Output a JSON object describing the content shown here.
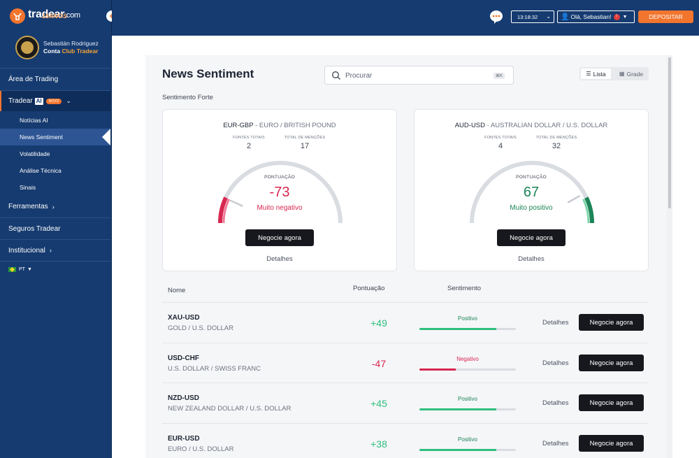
{
  "brand": {
    "name": "tradear",
    "domain": ".com",
    "tagline": "15ANOS",
    "accent": "#f2752e",
    "nav_bg": "#163b70"
  },
  "profile": {
    "name": "Sebastián Rodriguez",
    "club_prefix": "Conta",
    "club_name": "Club Tradear"
  },
  "menu": {
    "area_trading": "Área de Trading",
    "tradear_ai": "Tradear",
    "ai_tag": "AI",
    "novo_tag": "NOVO",
    "sub": [
      "Notícias AI",
      "News Sentiment",
      "Volatilidade",
      "Análise Técnica",
      "Sinais"
    ],
    "ferramentas": "Ferramentas",
    "seguros": "Seguros Tradear",
    "institucional": "Institucional",
    "language": "PT"
  },
  "topbar": {
    "time": "13:18:32",
    "greeting": "Olá, Sebastian!",
    "alert": "!",
    "deposit": "DEPOSITAR"
  },
  "page": {
    "title": "News Sentiment",
    "search_placeholder": "Procurar",
    "search_kbd": "⌘K",
    "view_list": "Lista",
    "view_grid": "Grade",
    "strong_label": "Sentimento Forte"
  },
  "cards": [
    {
      "symbol": "EUR-GBP",
      "name": " - EURO / BRITISH POUND",
      "sources_label": "FONTES TOTAIS",
      "sources": "2",
      "mentions_label": "TOTAL DE MENÇÕES",
      "mentions": "17",
      "score_label": "PONTUAÇÃO",
      "score": "-73",
      "score_value": -73,
      "sentiment": "Muito negativo",
      "cta": "Negocie agora",
      "details": "Detalhes"
    },
    {
      "symbol": "AUD-USD",
      "name": " - AUSTRALIAN DOLLAR / U.S. DOLLAR",
      "sources_label": "FONTES TOTAIS",
      "sources": "4",
      "mentions_label": "TOTAL DE MENÇÕES",
      "mentions": "32",
      "score_label": "PONTUAÇÃO",
      "score": "67",
      "score_value": 67,
      "sentiment": "Muito positivo",
      "cta": "Negocie agora",
      "details": "Detalhes"
    }
  ],
  "list": {
    "headers": {
      "name": "Nome",
      "score": "Pontuação",
      "sentiment": "Sentimento"
    },
    "rows": [
      {
        "symbol": "XAU-USD",
        "name": "GOLD / U.S. DOLLAR",
        "score": "+49",
        "sentiment": "Positivo",
        "level": 0.8,
        "polarity": "pos",
        "details": "Detalhes",
        "cta": "Negocie agora"
      },
      {
        "symbol": "USD-CHF",
        "name": "U.S. DOLLAR / SWISS FRANC",
        "score": "-47",
        "sentiment": "Negativo",
        "level": 0.38,
        "polarity": "neg",
        "details": "Detalhes",
        "cta": "Negocie agora"
      },
      {
        "symbol": "NZD-USD",
        "name": "NEW ZEALAND DOLLAR / U.S. DOLLAR",
        "score": "+45",
        "sentiment": "Positivo",
        "level": 0.8,
        "polarity": "pos",
        "details": "Detalhes",
        "cta": "Negocie agora"
      },
      {
        "symbol": "EUR-USD",
        "name": "EURO / U.S. DOLLAR",
        "score": "+38",
        "sentiment": "Positivo",
        "level": 0.8,
        "polarity": "pos",
        "details": "Detalhes",
        "cta": "Negocie agora"
      }
    ]
  },
  "colors": {
    "positive": "#2fbf7e",
    "positive_text": "#1c8457",
    "negative": "#d8274f",
    "gauge_track": "#d9dce1"
  }
}
